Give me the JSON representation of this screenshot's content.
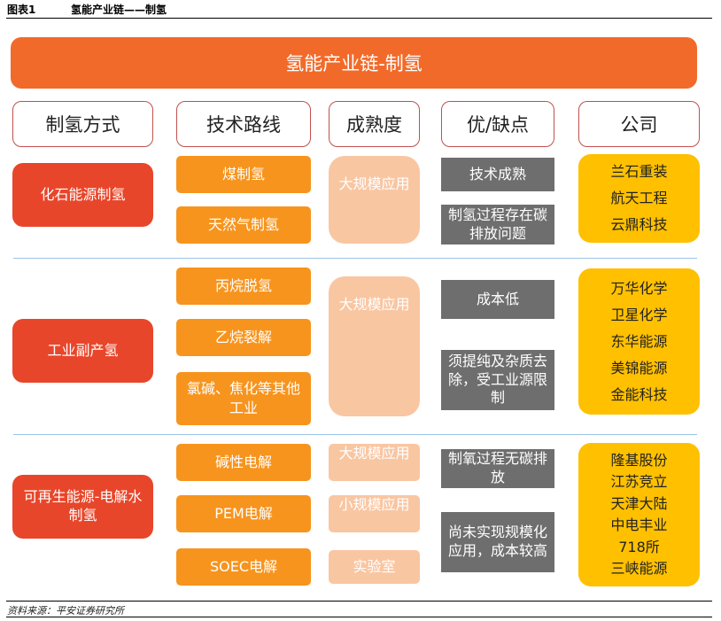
{
  "figure": {
    "label": "图表1",
    "title": "氢能产业链——制氢"
  },
  "banner": "氢能产业链-制氢",
  "headers": {
    "method": "制氢方式",
    "route": "技术路线",
    "maturity": "成熟度",
    "pros_cons": "优/缺点",
    "company": "公司"
  },
  "groups": [
    {
      "method": "化石能源制氢",
      "routes": [
        "煤制氢",
        "天然气制氢"
      ],
      "maturity": [
        "大规模应用"
      ],
      "pros_cons": [
        "技术成熟",
        "制氢过程存在碳排放问题"
      ],
      "companies": [
        "兰石重装",
        "航天工程",
        "云鼎科技"
      ]
    },
    {
      "method": "工业副产氢",
      "routes": [
        "丙烷脱氢",
        "乙烷裂解",
        "氯碱、焦化等其他工业"
      ],
      "maturity": [
        "大规模应用"
      ],
      "pros_cons": [
        "成本低",
        "须提纯及杂质去除，受工业源限制"
      ],
      "companies": [
        "万华化学",
        "卫星化学",
        "东华能源",
        "美锦能源",
        "金能科技"
      ]
    },
    {
      "method": "可再生能源-电解水制氢",
      "routes": [
        "碱性电解",
        "PEM电解",
        "SOEC电解"
      ],
      "maturity": [
        "大规模应用",
        "小规模应用",
        "实验室"
      ],
      "pros_cons": [
        "制氧过程无碳排放",
        "尚未实现规模化应用，成本较高"
      ],
      "companies": [
        "隆基股份",
        "江苏竞立",
        "天津大陆",
        "中电丰业",
        "718所",
        "三峡能源"
      ]
    }
  ],
  "source": "资料来源：平安证券研究所",
  "colors": {
    "banner": "#f26a2a",
    "method": "#e8462a",
    "route": "#f7941d",
    "maturity": "#f9c6a2",
    "pros_cons": "#6e6e6e",
    "company": "#ffc000",
    "header_border": "#c0504d",
    "separator": "#9dc3e6"
  }
}
